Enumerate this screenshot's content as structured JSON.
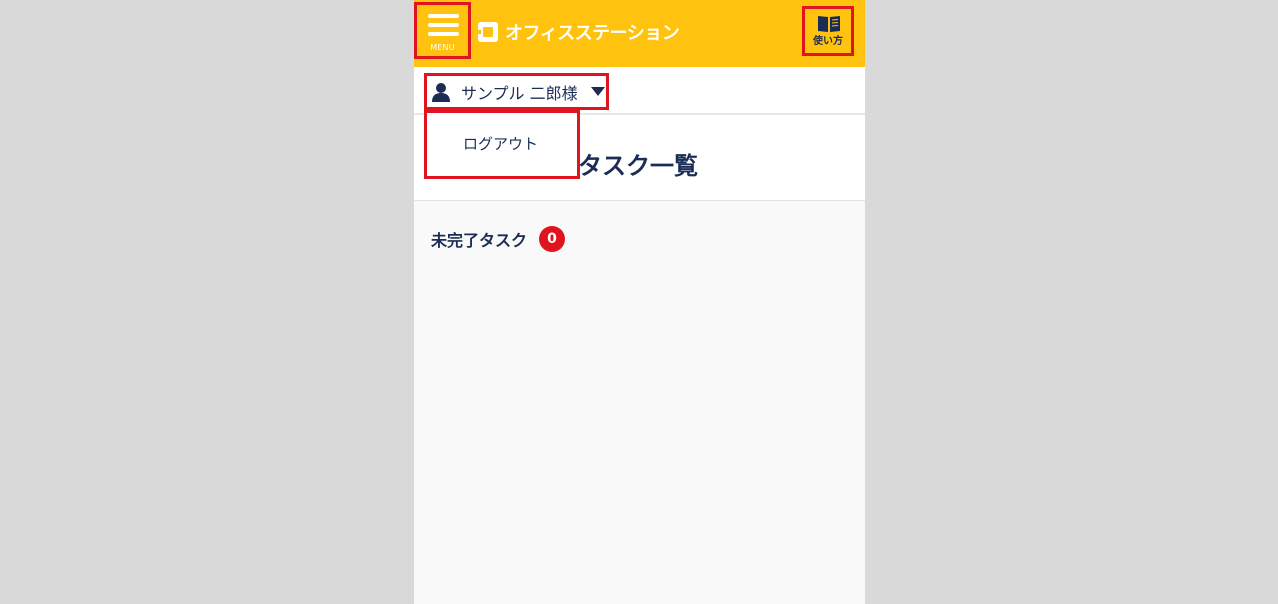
{
  "header": {
    "menu_label": "MENU",
    "brand_name": "オフィスステーション",
    "help_label": "使い方"
  },
  "user": {
    "name": "サンプル 二郎様"
  },
  "dropdown": {
    "items": [
      {
        "label": "ログアウト"
      }
    ]
  },
  "page": {
    "title": "タスク一覧"
  },
  "tasks": {
    "incomplete_label": "未完了タスク",
    "incomplete_count": "0"
  },
  "colors": {
    "header_bg": "#ffc20e",
    "highlight_border": "#e0141e",
    "text_navy": "#1b2d55",
    "badge": "#e0141e",
    "outer_bg": "#d9d9d9"
  },
  "icons": {
    "menu": "hamburger-icon",
    "brand": "brand-logo-icon",
    "help": "book-icon",
    "user": "user-icon",
    "dropdown": "chevron-down-icon"
  }
}
